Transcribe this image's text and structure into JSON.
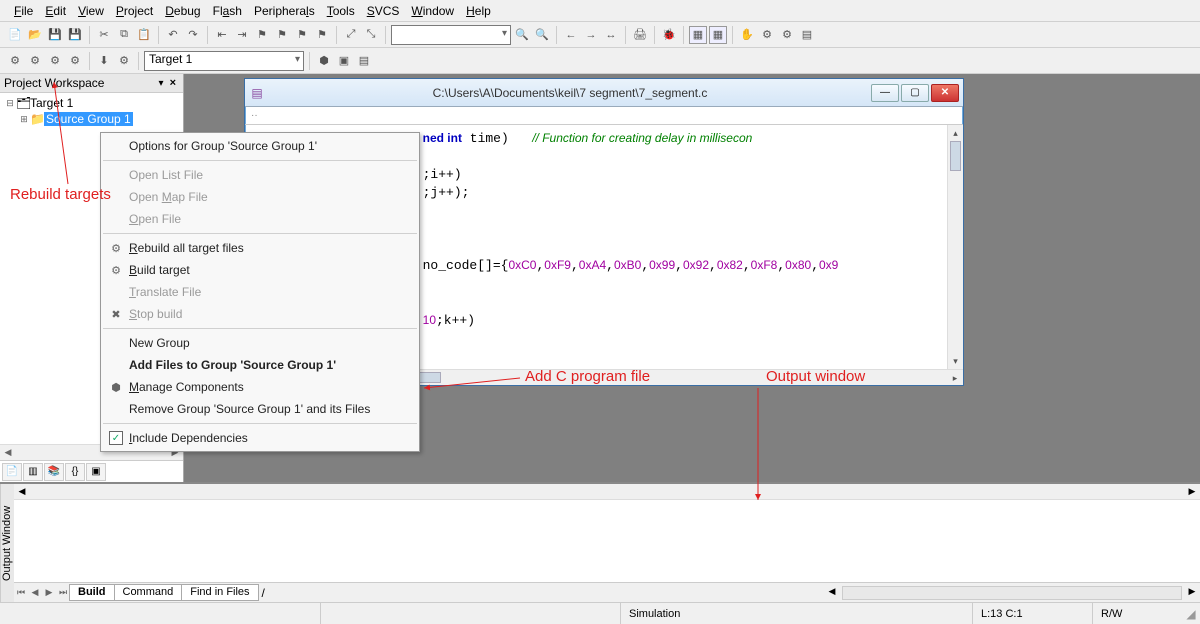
{
  "menu": {
    "items": [
      "File",
      "Edit",
      "View",
      "Project",
      "Debug",
      "Flash",
      "Peripherals",
      "Tools",
      "SVCS",
      "Window",
      "Help"
    ]
  },
  "toolbar2": {
    "target": "Target 1"
  },
  "workspace": {
    "title": "Project Workspace",
    "root": "Target 1",
    "group": "Source Group 1"
  },
  "doc": {
    "title": "C:\\Users\\A\\Documents\\keil\\7 segment\\7_segment.c",
    "code_lines": [
      {
        "pre": "",
        "kw": "ned int",
        "post": " time)   ",
        "cm": "// Function for creating delay in millisecon"
      },
      {
        "pre": "",
        "kw": "",
        "post": "",
        "cm": ""
      },
      {
        "pre": ";i++)",
        "kw": "",
        "post": "",
        "cm": ""
      },
      {
        "pre": ";j++);",
        "kw": "",
        "post": "",
        "cm": ""
      },
      {
        "pre": "",
        "kw": "",
        "post": "",
        "cm": ""
      },
      {
        "pre": "",
        "kw": "",
        "post": "",
        "cm": ""
      },
      {
        "pre": "",
        "kw": "",
        "post": "",
        "cm": ""
      },
      {
        "pre": "no_code[]={",
        "nums": "0xC0,0xF9,0xA4,0xB0,0x99,0x92,0x82,0xF8,0x80,0x9",
        "post": "",
        "cm": ""
      },
      {
        "pre": "",
        "kw": "",
        "post": "",
        "cm": ""
      },
      {
        "pre": "",
        "kw": "",
        "post": "",
        "cm": ""
      },
      {
        "pre": "",
        "nums": "10",
        "post": ";k++)",
        "pre2": "",
        "cm": ""
      }
    ]
  },
  "context": {
    "items": [
      {
        "label": "Options for Group 'Source Group 1'",
        "type": "normal"
      },
      {
        "type": "sep"
      },
      {
        "label": "Open List File",
        "type": "disabled"
      },
      {
        "label": "Open Map File",
        "type": "disabled",
        "u": "M"
      },
      {
        "label": "Open File",
        "type": "disabled",
        "u": "O"
      },
      {
        "type": "sep"
      },
      {
        "label": "Rebuild all target files",
        "type": "normal",
        "icon": "⚙",
        "u": "R"
      },
      {
        "label": "Build target",
        "type": "normal",
        "icon": "⚙",
        "u": "B"
      },
      {
        "label": "Translate File",
        "type": "disabled",
        "u": "T"
      },
      {
        "label": "Stop build",
        "type": "disabled",
        "icon": "✖",
        "u": "S"
      },
      {
        "type": "sep"
      },
      {
        "label": "New Group",
        "type": "normal"
      },
      {
        "label": "Add Files to Group 'Source Group 1'",
        "type": "bold"
      },
      {
        "label": "Manage Components",
        "type": "normal",
        "icon": "⬢",
        "u": "M"
      },
      {
        "label": "Remove Group 'Source Group 1' and its Files",
        "type": "normal"
      },
      {
        "type": "sep"
      },
      {
        "label": "Include Dependencies",
        "type": "check",
        "u": "I"
      }
    ]
  },
  "output": {
    "side": "Output Window",
    "tabs": [
      "Build",
      "Command",
      "Find in Files"
    ]
  },
  "status": {
    "sim": "Simulation",
    "pos": "L:13 C:1",
    "rw": "R/W"
  },
  "anno": {
    "rebuild": "Rebuild targets",
    "addc": "Add C program file",
    "outw": "Output window"
  }
}
